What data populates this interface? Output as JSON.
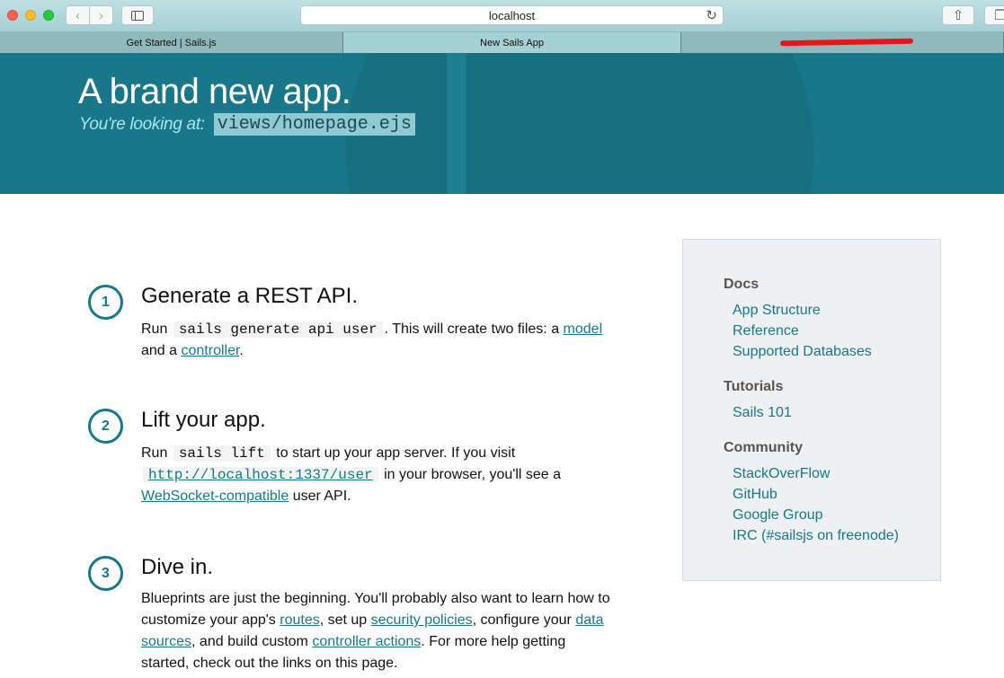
{
  "browser": {
    "url": "localhost",
    "tabs": [
      {
        "label": "Get Started  | Sails.js"
      },
      {
        "label": "New Sails App"
      },
      {
        "label": ""
      }
    ]
  },
  "hero": {
    "title": "A brand new app.",
    "subtitle_label": "You're looking at:",
    "subtitle_code": "views/homepage.ejs"
  },
  "steps": [
    {
      "number": "1",
      "title": "Generate a REST API.",
      "run": "Run",
      "code": "sails generate api user",
      "text1": ". This will create two files: a",
      "link1": "model",
      "text2": "and a",
      "link2": "controller",
      "text3": "."
    },
    {
      "number": "2",
      "title": "Lift your app.",
      "run": "Run",
      "code": "sails lift",
      "text1": "to start up your app server. If you visit",
      "code_link": "http://localhost:1337/user",
      "text2": "in your browser, you'll see a",
      "link1": "WebSocket-compatible",
      "text3": "user API."
    },
    {
      "number": "3",
      "title": "Dive in.",
      "text1": "Blueprints are just the beginning. You'll probably also want to learn how to customize your app's",
      "link1": "routes",
      "text2": ", set up",
      "link2": "security policies",
      "text3": ", configure your",
      "link3": "data sources",
      "text4": ", and build custom",
      "link4": "controller actions",
      "text5": ". For more help getting started, check out the links on this page."
    }
  ],
  "sidebar": {
    "sections": [
      {
        "heading": "Docs",
        "links": [
          "App Structure",
          "Reference",
          "Supported Databases"
        ]
      },
      {
        "heading": "Tutorials",
        "links": [
          "Sails 101"
        ]
      },
      {
        "heading": "Community",
        "links": [
          "StackOverFlow",
          "GitHub",
          "Google Group",
          "IRC (#sailsjs on freenode)"
        ]
      }
    ]
  },
  "colors": {
    "accent": "#187789",
    "hero_bg": "#187789",
    "panel_bg": "#eef0f2"
  }
}
